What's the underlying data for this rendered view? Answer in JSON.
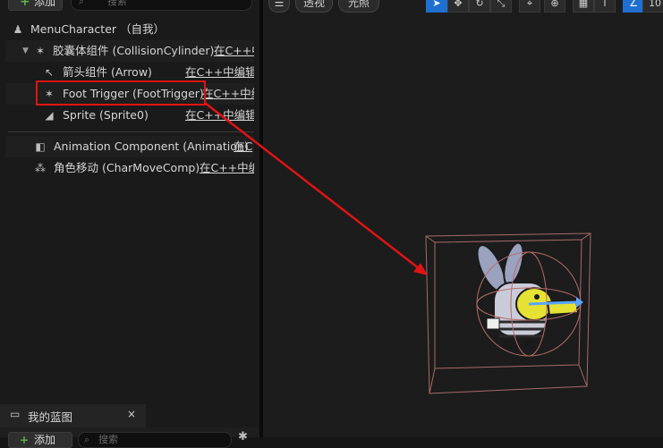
{
  "components_panel": {
    "add_button": {
      "icon": "plus-icon",
      "label": "添加"
    },
    "search": {
      "icon": "search-icon",
      "placeholder": "搜索"
    },
    "items": [
      {
        "icon": "actor-icon",
        "name": "MenuCharacter （自我）",
        "edit": ""
      },
      {
        "icon": "capsule-icon",
        "name": "胶囊体组件 (CollisionCylinder)",
        "edit": "在C++中"
      },
      {
        "icon": "arrow-component-icon",
        "name": "箭头组件 (Arrow)",
        "edit": "在C++中编辑"
      },
      {
        "icon": "trigger-icon",
        "name": "Foot Trigger (FootTrigger)",
        "edit": "在C++中编"
      },
      {
        "icon": "sprite-icon",
        "name": "Sprite (Sprite0)",
        "edit": "在C++中编辑"
      },
      {
        "icon": "animation-component-icon",
        "name": "Animation Component (Animation)",
        "edit": "在C"
      },
      {
        "icon": "movement-component-icon",
        "name": "角色移动 (CharMoveComp)",
        "edit": "在C++中编"
      }
    ]
  },
  "my_blueprint": {
    "tab_label": "我的蓝图",
    "close": "×",
    "add_label": "添加",
    "search_placeholder": "搜索"
  },
  "viewport": {
    "view_mode": "透视",
    "lighting_mode": "光照",
    "grid_snap_value": "10",
    "highlight_color": "#e01414",
    "accent_color": "#1f6fd1"
  }
}
